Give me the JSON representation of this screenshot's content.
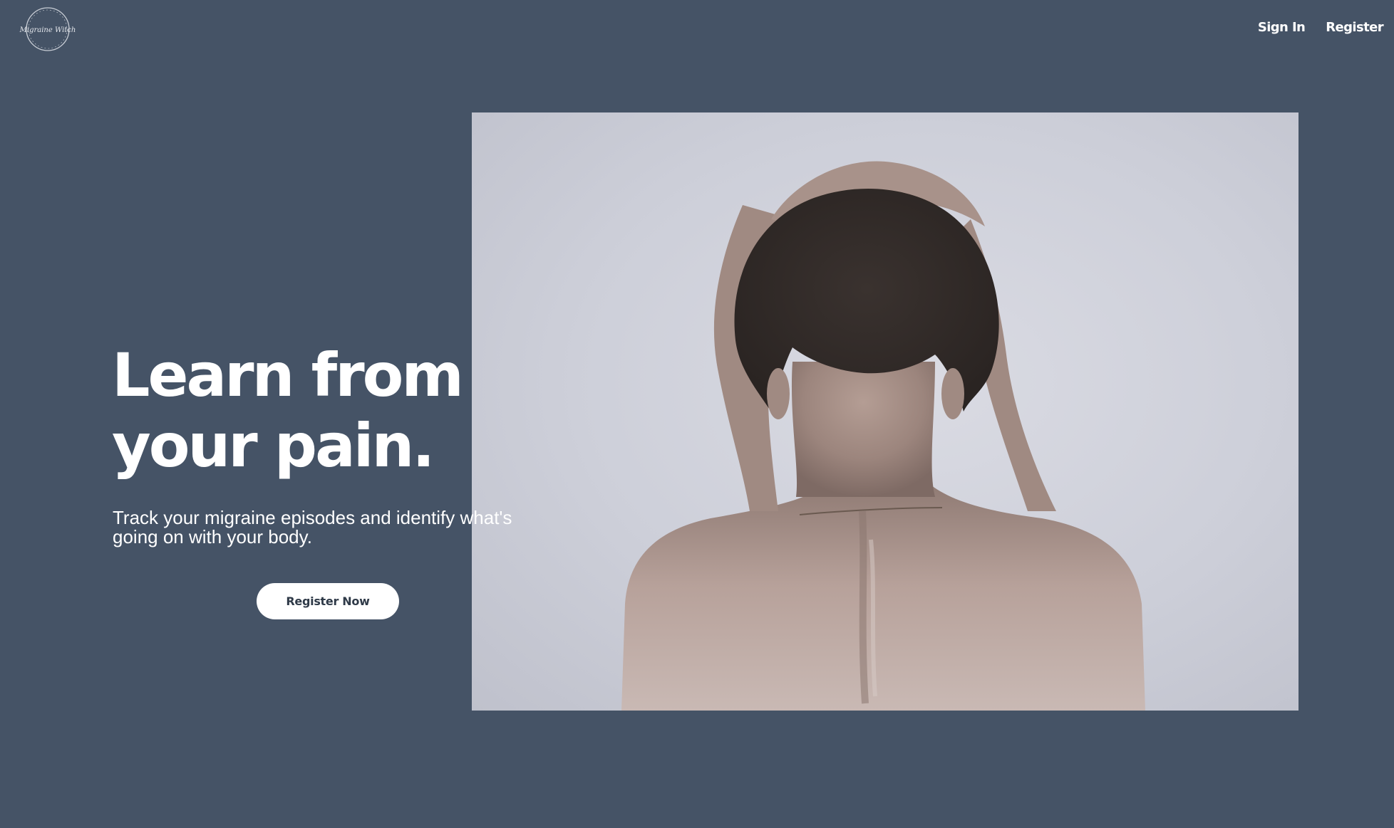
{
  "header": {
    "logo_text": "Migraine Witch",
    "nav": {
      "sign_in": "Sign In",
      "register": "Register"
    }
  },
  "hero": {
    "title_line1": "Learn from",
    "title_line2": "your pain.",
    "subtitle": "Track your migraine episodes and identify what's going on with your body.",
    "cta_label": "Register Now"
  },
  "colors": {
    "background": "#455366",
    "text": "#ffffff",
    "button_bg": "#ffffff",
    "button_text": "#2f3a48"
  }
}
